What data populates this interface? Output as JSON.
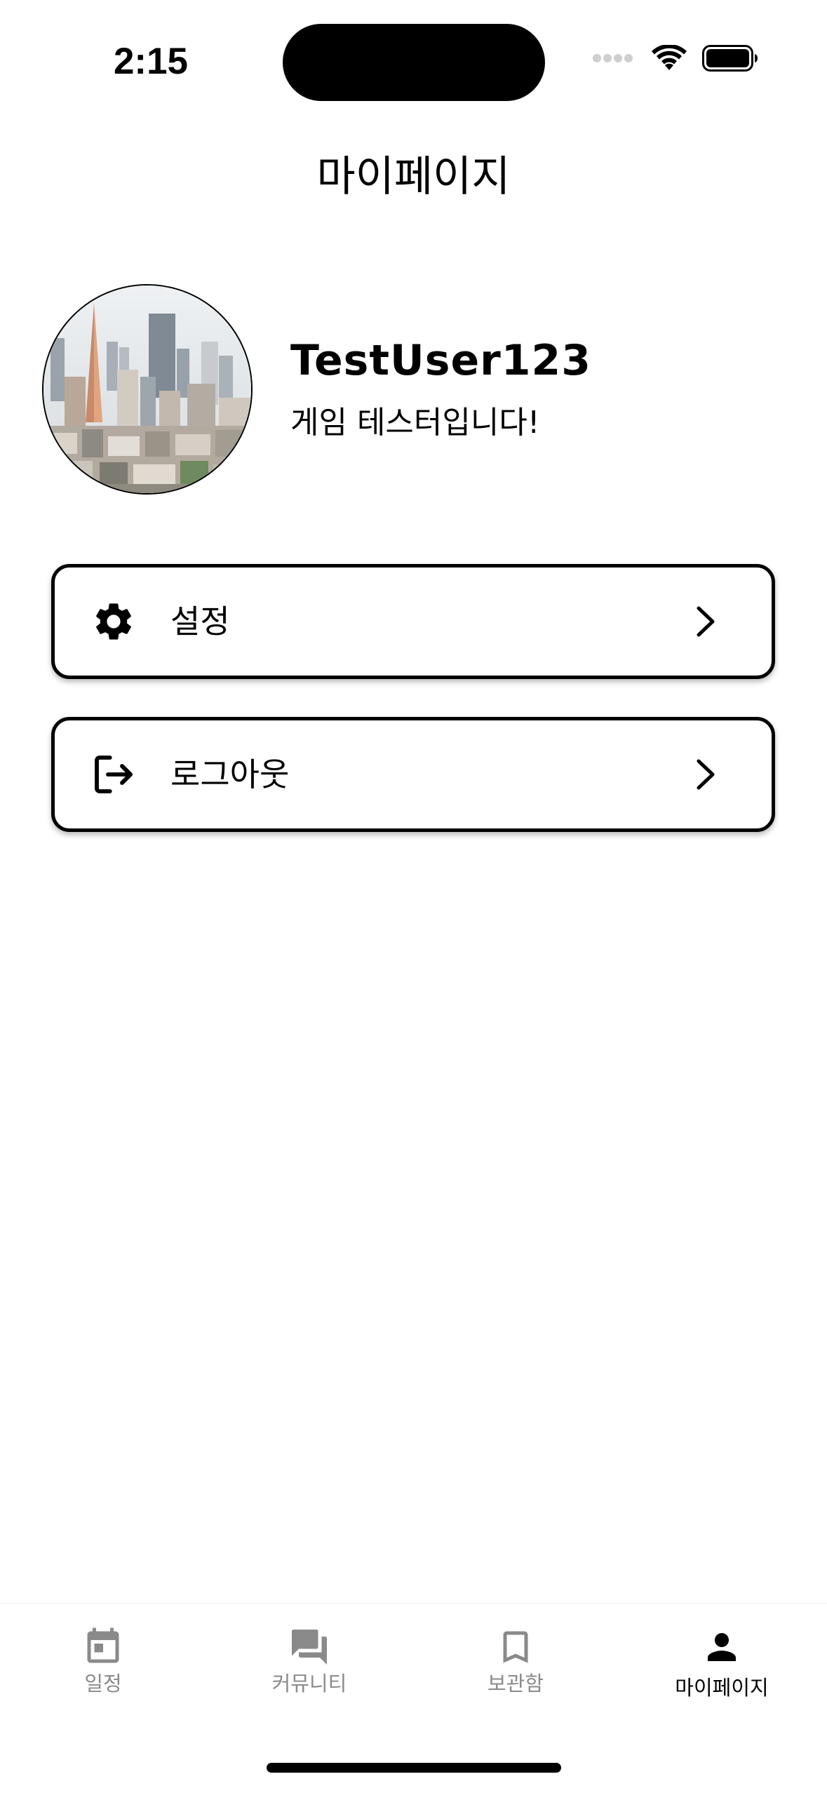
{
  "status_bar": {
    "time": "2:15"
  },
  "header": {
    "title": "마이페이지"
  },
  "profile": {
    "name": "TestUser123",
    "bio": "게임 테스터입니다!"
  },
  "menu": [
    {
      "label": "설정",
      "icon": "gear-icon"
    },
    {
      "label": "로그아웃",
      "icon": "logout-icon"
    }
  ],
  "tab_bar": {
    "items": [
      {
        "label": "일정",
        "icon": "calendar-icon",
        "active": false
      },
      {
        "label": "커뮤니티",
        "icon": "chat-icon",
        "active": false
      },
      {
        "label": "보관함",
        "icon": "bookmark-icon",
        "active": false
      },
      {
        "label": "마이페이지",
        "icon": "person-icon",
        "active": true
      }
    ]
  },
  "colors": {
    "background": "#ffffff",
    "text": "#000000",
    "inactive_tab": "#8a8a8a",
    "active_tab": "#000000"
  }
}
